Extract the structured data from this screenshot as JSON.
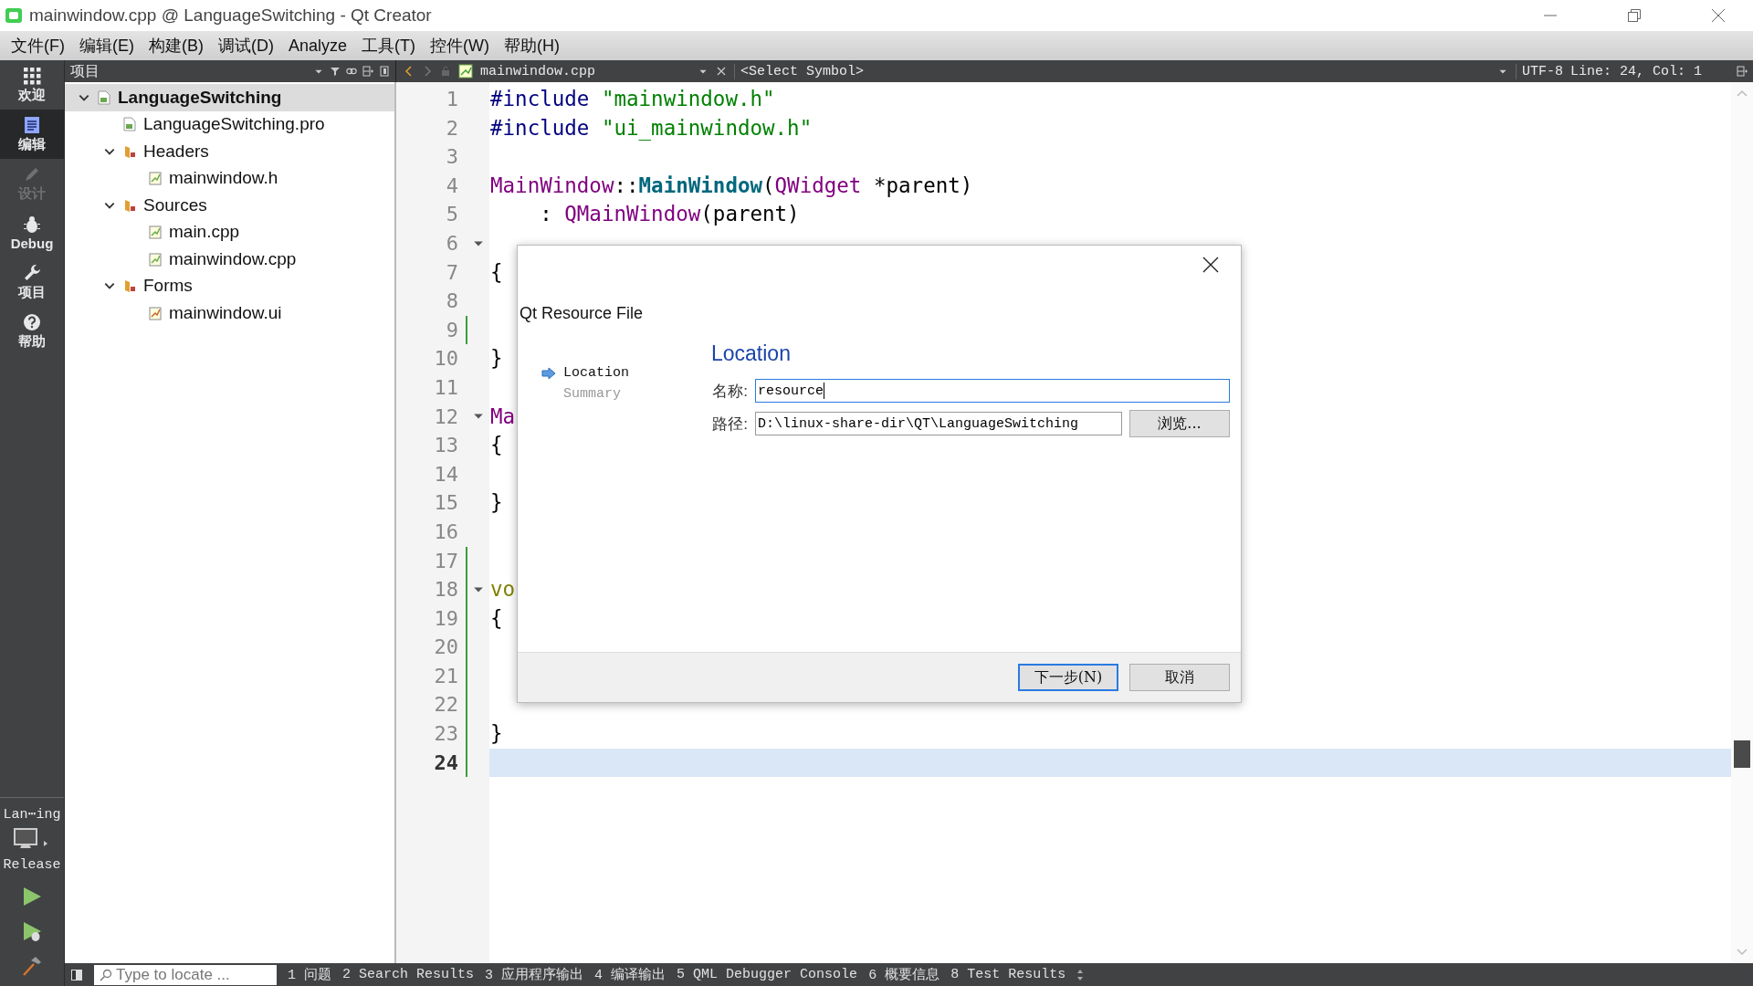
{
  "window": {
    "title": "mainwindow.cpp @ LanguageSwitching - Qt Creator"
  },
  "menu": [
    "文件(F)",
    "编辑(E)",
    "构建(B)",
    "调试(D)",
    "Analyze",
    "工具(T)",
    "控件(W)",
    "帮助(H)"
  ],
  "modes": [
    {
      "label": "欢迎",
      "kind": "welcome",
      "selected": false,
      "disabled": false
    },
    {
      "label": "编辑",
      "kind": "edit",
      "selected": true,
      "disabled": false
    },
    {
      "label": "设计",
      "kind": "design",
      "selected": false,
      "disabled": true
    },
    {
      "label": "Debug",
      "kind": "debug",
      "selected": false,
      "disabled": false
    },
    {
      "label": "项目",
      "kind": "projects",
      "selected": false,
      "disabled": false
    },
    {
      "label": "帮助",
      "kind": "help",
      "selected": false,
      "disabled": false
    }
  ],
  "build_target": {
    "project": "Lan⋯ing",
    "config": "Release"
  },
  "project_pane": {
    "title": "项目",
    "tree": [
      {
        "label": "LanguageSwitching",
        "kind": "project",
        "selected": true,
        "expanded": true,
        "children": [
          {
            "label": "LanguageSwitching.pro",
            "kind": "pro",
            "selected": false
          },
          {
            "label": "Headers",
            "kind": "headers",
            "selected": false,
            "expanded": true,
            "children": [
              {
                "label": "mainwindow.h",
                "kind": "source",
                "selected": false
              }
            ]
          },
          {
            "label": "Sources",
            "kind": "sources",
            "selected": false,
            "expanded": true,
            "children": [
              {
                "label": "main.cpp",
                "kind": "source",
                "selected": false
              },
              {
                "label": "mainwindow.cpp",
                "kind": "source",
                "selected": false
              }
            ]
          },
          {
            "label": "Forms",
            "kind": "forms",
            "selected": false,
            "expanded": true,
            "children": [
              {
                "label": "mainwindow.ui",
                "kind": "form",
                "selected": false
              }
            ]
          }
        ]
      }
    ]
  },
  "editor": {
    "file": "mainwindow.cpp",
    "symbol": "<Select Symbol>",
    "encoding": "UTF-8",
    "position": "Line: 24, Col: 1",
    "lines": [
      {
        "number": "1",
        "fold": false,
        "changed": false,
        "current": false,
        "tokens": [
          {
            "t": "#include ",
            "kind": "directive"
          },
          {
            "t": "\"mainwindow.h\"",
            "kind": "string"
          }
        ]
      },
      {
        "number": "2",
        "fold": false,
        "changed": false,
        "current": false,
        "tokens": [
          {
            "t": "#include ",
            "kind": "directive"
          },
          {
            "t": "\"ui_mainwindow.h\"",
            "kind": "string"
          }
        ]
      },
      {
        "number": "3",
        "fold": false,
        "changed": false,
        "current": false
      },
      {
        "number": "4",
        "fold": false,
        "changed": false,
        "current": false,
        "tokens": [
          {
            "t": "MainWindow",
            "kind": "type"
          },
          {
            "t": "::",
            "kind": "plain"
          },
          {
            "t": "MainWindow",
            "kind": "func"
          },
          {
            "t": "(",
            "kind": "plain"
          },
          {
            "t": "QWidget",
            "kind": "type"
          },
          {
            "t": " *parent)",
            "kind": "plain"
          }
        ]
      },
      {
        "number": "5",
        "fold": false,
        "changed": false,
        "current": false,
        "tokens": [
          {
            "t": "    : ",
            "kind": "plain"
          },
          {
            "t": "QMainWindow",
            "kind": "type"
          },
          {
            "t": "(parent)",
            "kind": "plain"
          }
        ]
      },
      {
        "number": "6",
        "fold": true,
        "changed": false,
        "current": false
      },
      {
        "number": "7",
        "fold": false,
        "changed": false,
        "current": false,
        "tokens": [
          {
            "t": "{",
            "kind": "plain"
          }
        ]
      },
      {
        "number": "8",
        "fold": false,
        "changed": false,
        "current": false
      },
      {
        "number": "9",
        "fold": false,
        "changed": true,
        "current": false
      },
      {
        "number": "10",
        "fold": false,
        "changed": false,
        "current": false,
        "tokens": [
          {
            "t": "}",
            "kind": "plain"
          }
        ]
      },
      {
        "number": "11",
        "fold": false,
        "changed": false,
        "current": false
      },
      {
        "number": "12",
        "fold": true,
        "changed": false,
        "current": false,
        "tokens": [
          {
            "t": "Ma",
            "kind": "type"
          }
        ]
      },
      {
        "number": "13",
        "fold": false,
        "changed": false,
        "current": false,
        "tokens": [
          {
            "t": "{",
            "kind": "plain"
          }
        ]
      },
      {
        "number": "14",
        "fold": false,
        "changed": false,
        "current": false
      },
      {
        "number": "15",
        "fold": false,
        "changed": false,
        "current": false,
        "tokens": [
          {
            "t": "}",
            "kind": "plain"
          }
        ]
      },
      {
        "number": "16",
        "fold": false,
        "changed": false,
        "current": false
      },
      {
        "number": "17",
        "fold": false,
        "changed": true,
        "current": false
      },
      {
        "number": "18",
        "fold": true,
        "changed": true,
        "current": false,
        "tokens": [
          {
            "t": "vo",
            "kind": "keyword"
          }
        ]
      },
      {
        "number": "19",
        "fold": false,
        "changed": true,
        "current": false,
        "tokens": [
          {
            "t": "{",
            "kind": "plain"
          }
        ]
      },
      {
        "number": "20",
        "fold": false,
        "changed": true,
        "current": false
      },
      {
        "number": "21",
        "fold": false,
        "changed": true,
        "current": false
      },
      {
        "number": "22",
        "fold": false,
        "changed": true,
        "current": false
      },
      {
        "number": "23",
        "fold": false,
        "changed": true,
        "current": false,
        "tokens": [
          {
            "t": "}",
            "kind": "plain"
          }
        ]
      },
      {
        "number": "24",
        "fold": false,
        "changed": true,
        "current": true
      }
    ]
  },
  "dialog": {
    "title": "Qt Resource File",
    "steps": [
      {
        "label": "Location",
        "selected": true
      },
      {
        "label": "Summary",
        "selected": false
      }
    ],
    "heading": "Location",
    "fields": [
      {
        "label": "名称:",
        "value": "resource",
        "focused": true
      },
      {
        "label": "路径:",
        "value": "D:\\linux-share-dir\\QT\\LanguageSwitching",
        "focused": false,
        "button": "浏览..."
      }
    ],
    "buttons": [
      {
        "label": "下一步(N)",
        "default": true
      },
      {
        "label": "取消",
        "default": false
      }
    ]
  },
  "locator": {
    "placeholder": "Type to locate ..."
  },
  "output_tabs": [
    "1 问题",
    "2 Search Results",
    "3 应用程序输出",
    "4 编译输出",
    "5 QML Debugger Console",
    "6 概要信息",
    "8 Test Results"
  ]
}
